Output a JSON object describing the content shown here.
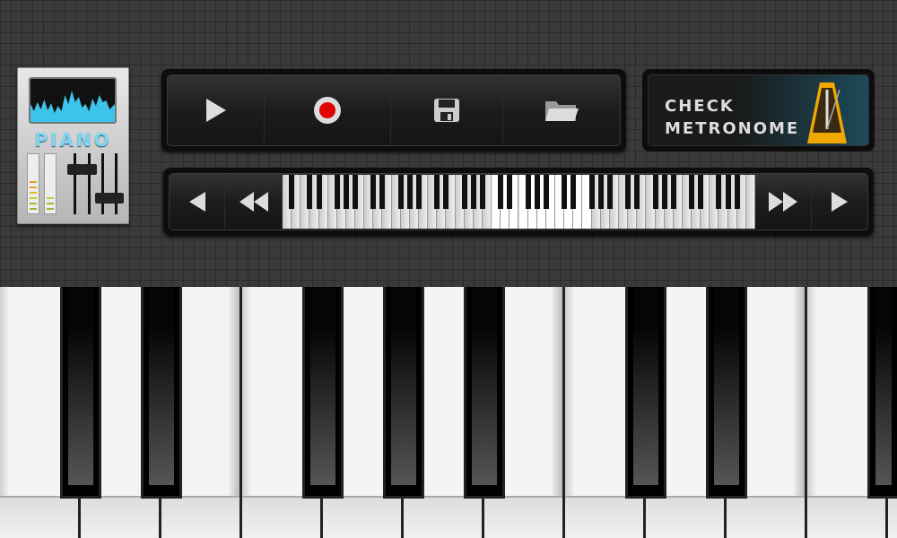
{
  "logo": {
    "text": "PIANO",
    "accent": "#7fd6f0"
  },
  "toolbar": {
    "buttons": [
      {
        "name": "play",
        "icon": "play-icon"
      },
      {
        "name": "record",
        "icon": "record-icon",
        "color": "#e00000"
      },
      {
        "name": "save",
        "icon": "floppy-disk-icon"
      },
      {
        "name": "open",
        "icon": "folder-icon"
      }
    ]
  },
  "metronome": {
    "line1": "CHECK",
    "line2": "METRONOME",
    "icon": "metronome-icon"
  },
  "navigator": {
    "buttons": [
      "scroll-left",
      "fast-scroll-left",
      "fast-scroll-right",
      "scroll-right"
    ],
    "mini_keys_white": 52
  },
  "keyboard": {
    "white_keys": 11,
    "black_after": [
      0,
      1,
      3,
      4,
      5,
      7,
      8,
      10
    ]
  }
}
